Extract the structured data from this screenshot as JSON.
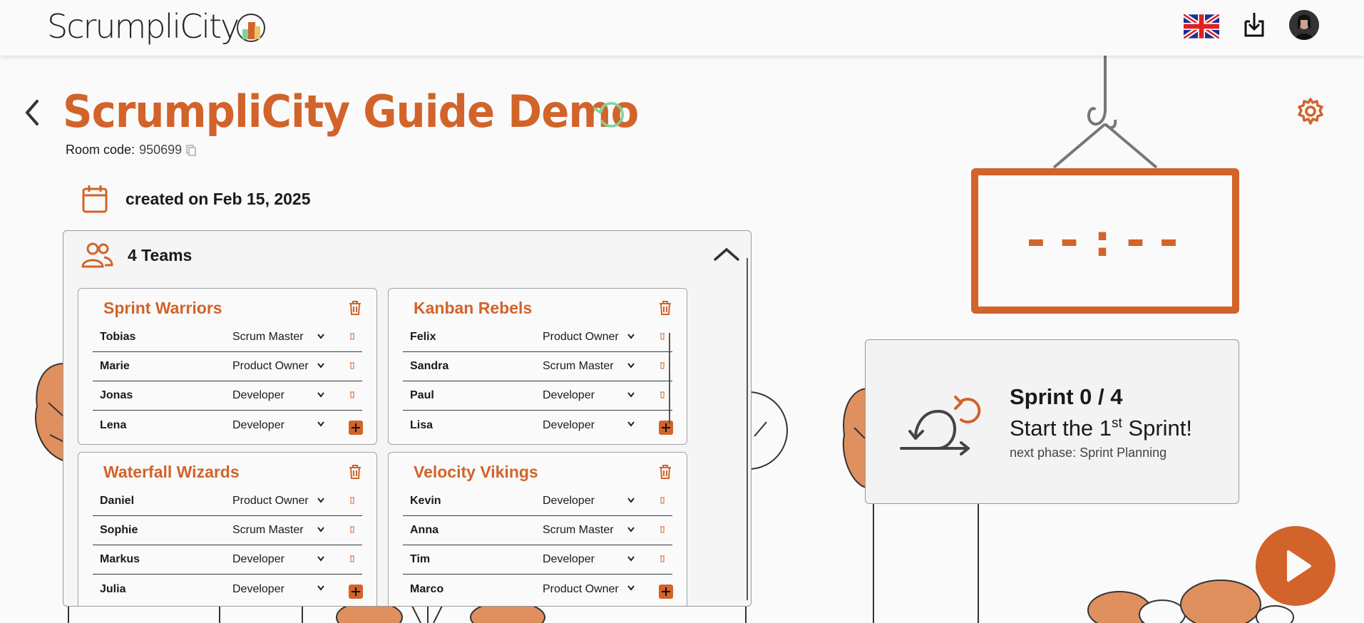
{
  "header": {
    "logo_text": "ScrumpliCity",
    "language": "English"
  },
  "room": {
    "title": "ScrumpliCity Guide Demo",
    "code_label": "Room code:",
    "code": "950699",
    "created": "created on Feb 15, 2025"
  },
  "teams": {
    "heading": "4 Teams",
    "list": [
      {
        "name": "Sprint Warriors",
        "members": [
          {
            "name": "Tobias",
            "role": "Scrum Master"
          },
          {
            "name": "Marie",
            "role": "Product Owner"
          },
          {
            "name": "Jonas",
            "role": "Developer"
          },
          {
            "name": "Lena",
            "role": "Developer"
          }
        ]
      },
      {
        "name": "Kanban Rebels",
        "members": [
          {
            "name": "Felix",
            "role": "Product Owner"
          },
          {
            "name": "Sandra",
            "role": "Scrum Master"
          },
          {
            "name": "Paul",
            "role": "Developer"
          },
          {
            "name": "Lisa",
            "role": "Developer"
          }
        ]
      },
      {
        "name": "Waterfall Wizards",
        "members": [
          {
            "name": "Daniel",
            "role": "Product Owner"
          },
          {
            "name": "Sophie",
            "role": "Scrum Master"
          },
          {
            "name": "Markus",
            "role": "Developer"
          },
          {
            "name": "Julia",
            "role": "Developer"
          }
        ]
      },
      {
        "name": "Velocity Vikings",
        "members": [
          {
            "name": "Kevin",
            "role": "Developer"
          },
          {
            "name": "Anna",
            "role": "Scrum Master"
          },
          {
            "name": "Tim",
            "role": "Developer"
          },
          {
            "name": "Marco",
            "role": "Product Owner"
          }
        ]
      }
    ]
  },
  "timer": {
    "display": "--:--"
  },
  "sprint": {
    "count": "Sprint 0 / 4",
    "phase_prefix": "Start the 1",
    "phase_sup": "st",
    "phase_suffix": " Sprint!",
    "next_phase": "next phase: Sprint Planning"
  },
  "colors": {
    "accent": "#d2632a",
    "refresh": "#7fd3a0",
    "text": "#1a1a1a"
  }
}
